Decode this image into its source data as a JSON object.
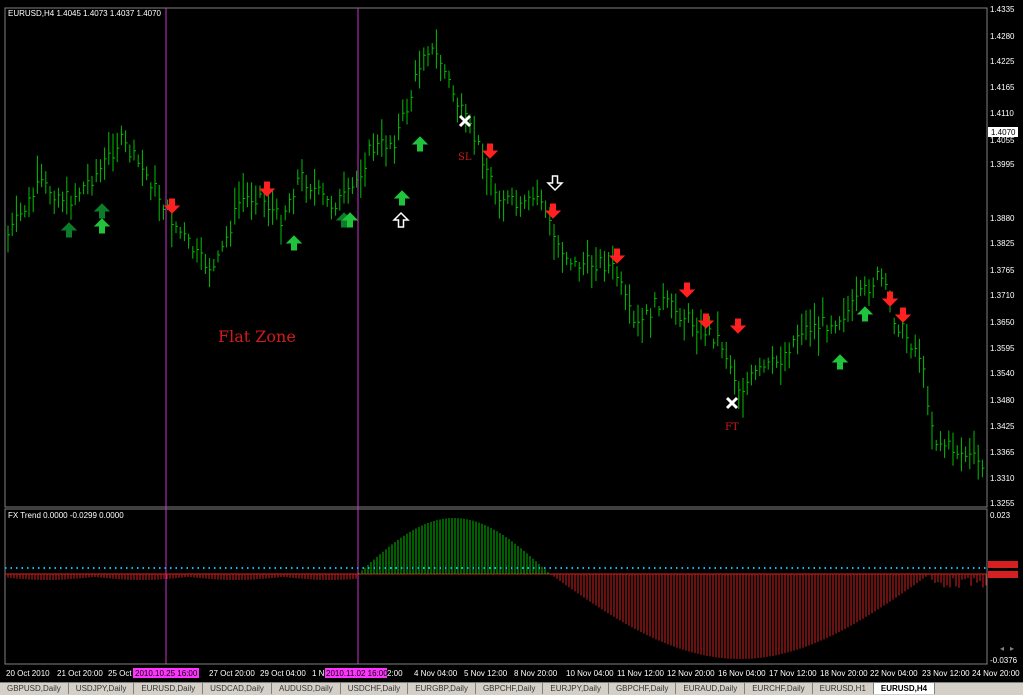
{
  "main_chart": {
    "header": "EURUSD,H4  1.4045 1.4073 1.4037 1.4070",
    "price_labels": [
      "1.4335",
      "1.4280",
      "1.4225",
      "1.4165",
      "1.4110",
      "1.4055",
      "1.3995",
      "1.3880",
      "1.3825",
      "1.3765",
      "1.3710",
      "1.3650",
      "1.3595",
      "1.3540",
      "1.3480",
      "1.3425",
      "1.3365",
      "1.3310",
      "1.3255"
    ],
    "current_price": "1.4070",
    "annotations": {
      "flat_zone": "Flat Zone",
      "sl": "SL",
      "ft": "FT"
    }
  },
  "indicator": {
    "header": "FX Trend 0.0000 -0.0299 0.0000",
    "top_label": "0.023",
    "bottom_label": "-0.0376"
  },
  "time_axis": {
    "labels": [
      "20 Oct 2010",
      "21 Oct 20:00",
      "25 Oct",
      "27 Oct 20:00",
      "29 Oct 04:00",
      "1 No",
      "2:00",
      "4 Nov 04:00",
      "5 Nov 12:00",
      "8 Nov 20:00",
      "10 Nov 04:00",
      "11 Nov 12:00",
      "12 Nov 20:00",
      "16 Nov 04:00",
      "17 Nov 12:00",
      "18 Nov 20:00",
      "22 Nov 04:00",
      "23 Nov 12:00",
      "24 Nov 20:00"
    ],
    "highlight_1": "2010.10.25 16:00",
    "highlight_2": "2010.11.02 16:00"
  },
  "tabs": [
    "GBPUSD,Daily",
    "USDJPY,Daily",
    "EURUSD,Daily",
    "USDCAD,Daily",
    "AUDUSD,Daily",
    "USDCHF,Daily",
    "EURGBP,Daily",
    "GBPCHF,Daily",
    "EURJPY,Daily",
    "GBPCHF,Daily",
    "EURAUD,Daily",
    "EURCHF,Daily",
    "EURUSD,H1",
    "EURUSD,H4"
  ],
  "active_tab": "EURUSD,H4",
  "colors": {
    "bar": "#00c000",
    "grid": "#2a2a2a",
    "up_arrow": "#21c23c",
    "dark_up_arrow": "#0b7d2a",
    "down_arrow": "#ff2020",
    "vline": "#cc33cc",
    "hist_pos": "#00c000",
    "hist_neg": "#d22020",
    "dots": "#00bfff"
  }
}
